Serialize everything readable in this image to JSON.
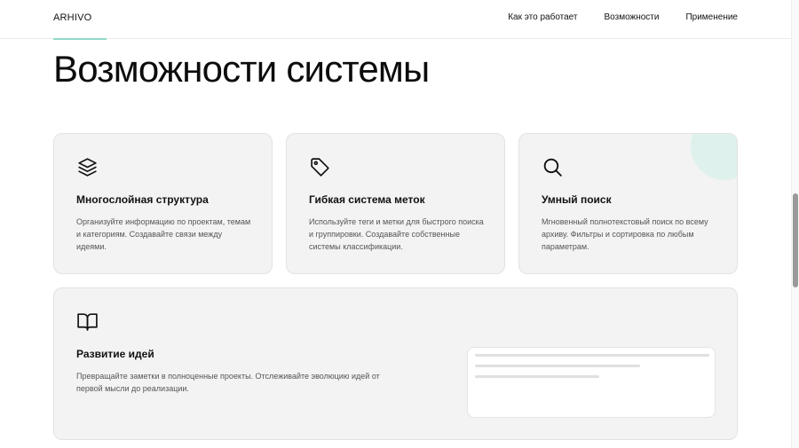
{
  "header": {
    "logo": "ARHIVO",
    "nav": [
      "Как это работает",
      "Возможности",
      "Применение"
    ]
  },
  "main": {
    "title": "Возможности системы",
    "features": [
      {
        "icon": "layers-icon",
        "title": "Многослойная структура",
        "text": "Организуйте информацию по проектам, темам и категориям. Создавайте связи между идеями."
      },
      {
        "icon": "tag-icon",
        "title": "Гибкая система меток",
        "text": "Используйте теги и метки для быстрого поиска и группировки. Создавайте собственные системы классификации."
      },
      {
        "icon": "search-icon",
        "title": "Умный поиск",
        "text": "Мгновенный полнотекстовый поиск по всему архиву. Фильтры и сортировка по любым параметрам."
      }
    ],
    "wide_feature": {
      "icon": "book-open-icon",
      "title": "Развитие идей",
      "text": "Превращайте заметки в полноценные проекты. Отслеживайте эволюцию идей от первой мысли до реализации."
    }
  },
  "colors": {
    "accent": "#8fd9c9",
    "card_bg": "#f3f3f3",
    "decor_circle": "#dff1ec"
  }
}
